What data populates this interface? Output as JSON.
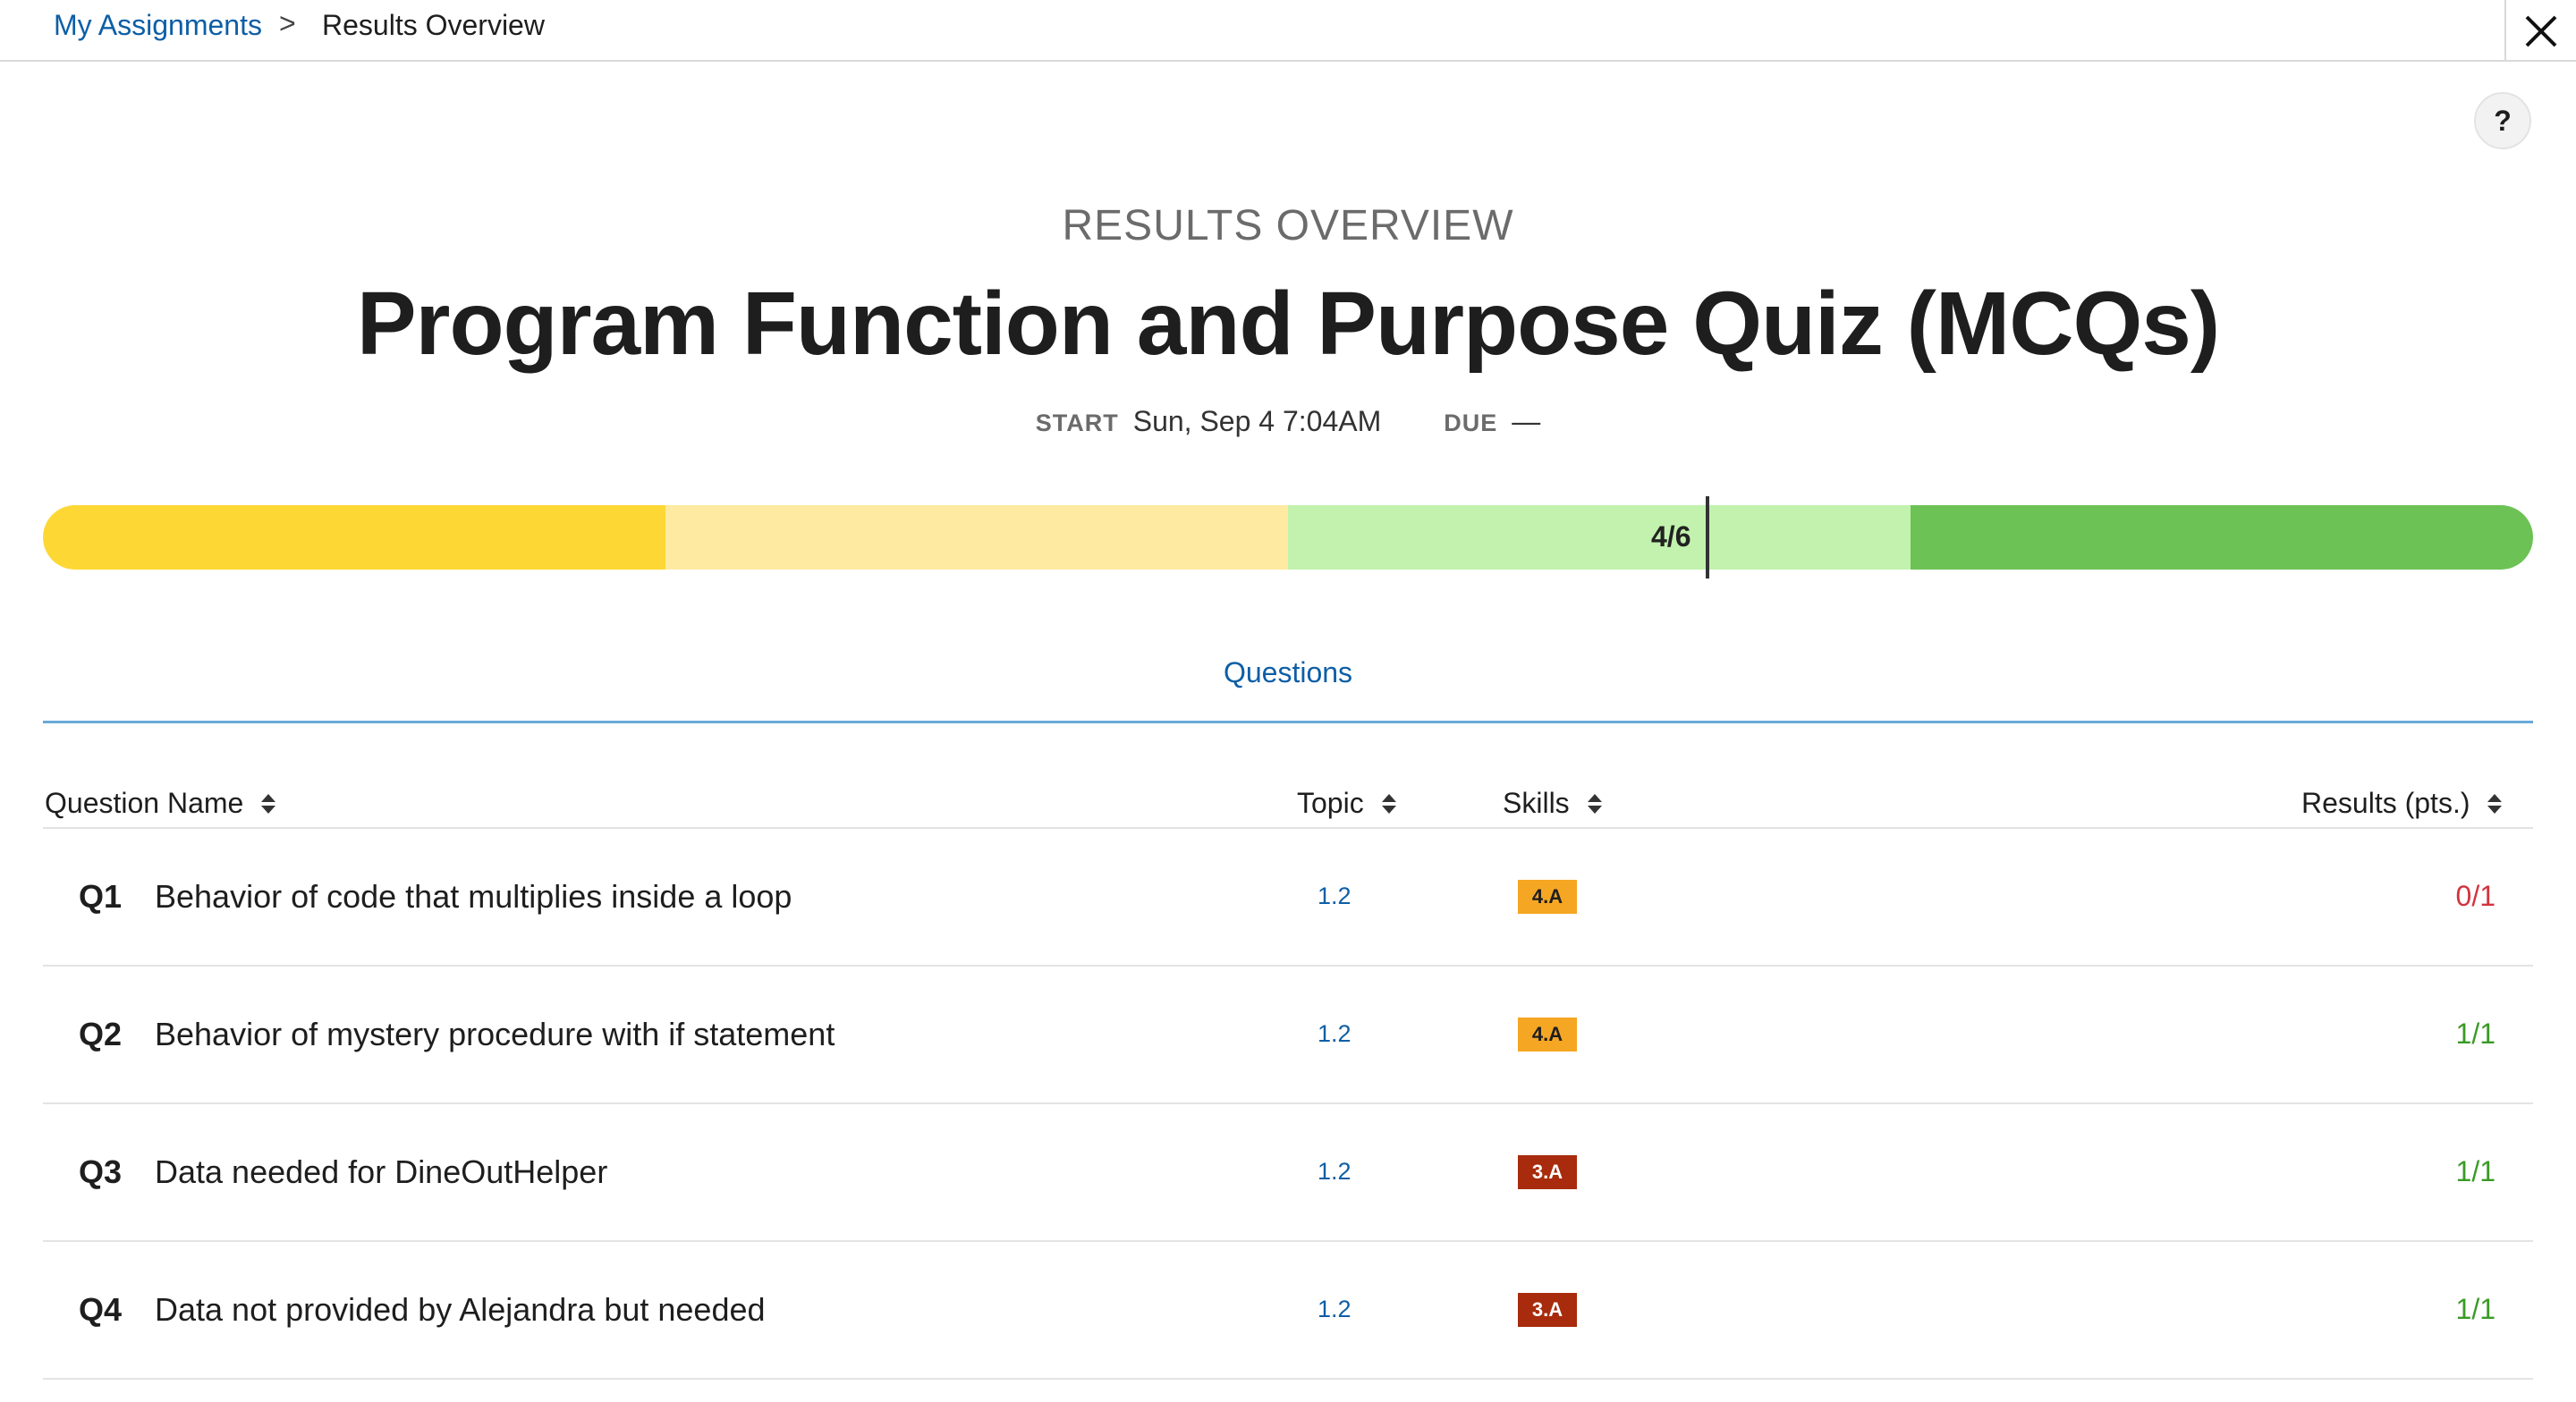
{
  "breadcrumb": {
    "link": "My Assignments",
    "separator": ">",
    "current": "Results Overview"
  },
  "help": {
    "label": "?"
  },
  "header": {
    "eyebrow": "RESULTS OVERVIEW",
    "title": "Program Function and Purpose Quiz (MCQs)",
    "start_label": "START",
    "start_value": "Sun, Sep 4 7:04AM",
    "due_label": "DUE",
    "due_value": "—"
  },
  "progress": {
    "score_label": "4/6",
    "score": 4,
    "max": 6,
    "colors": [
      "#fdd835",
      "#feeaa1",
      "#c2f2ad",
      "#6cc255"
    ]
  },
  "tabs": {
    "questions": "Questions"
  },
  "table": {
    "headers": {
      "name": "Question Name",
      "topic": "Topic",
      "skills": "Skills",
      "results": "Results (pts.)"
    },
    "rows": [
      {
        "num": "Q1",
        "name": "Behavior of code that multiplies inside a loop",
        "topic": "1.2",
        "skill": "4.A",
        "skill_color": "orange",
        "result": "0/1",
        "status": "bad"
      },
      {
        "num": "Q2",
        "name": "Behavior of mystery procedure with if statement",
        "topic": "1.2",
        "skill": "4.A",
        "skill_color": "orange",
        "result": "1/1",
        "status": "good"
      },
      {
        "num": "Q3",
        "name": "Data needed for DineOutHelper",
        "topic": "1.2",
        "skill": "3.A",
        "skill_color": "red",
        "result": "1/1",
        "status": "good"
      },
      {
        "num": "Q4",
        "name": "Data not provided by Alejandra but needed",
        "topic": "1.2",
        "skill": "3.A",
        "skill_color": "red",
        "result": "1/1",
        "status": "good"
      }
    ]
  }
}
